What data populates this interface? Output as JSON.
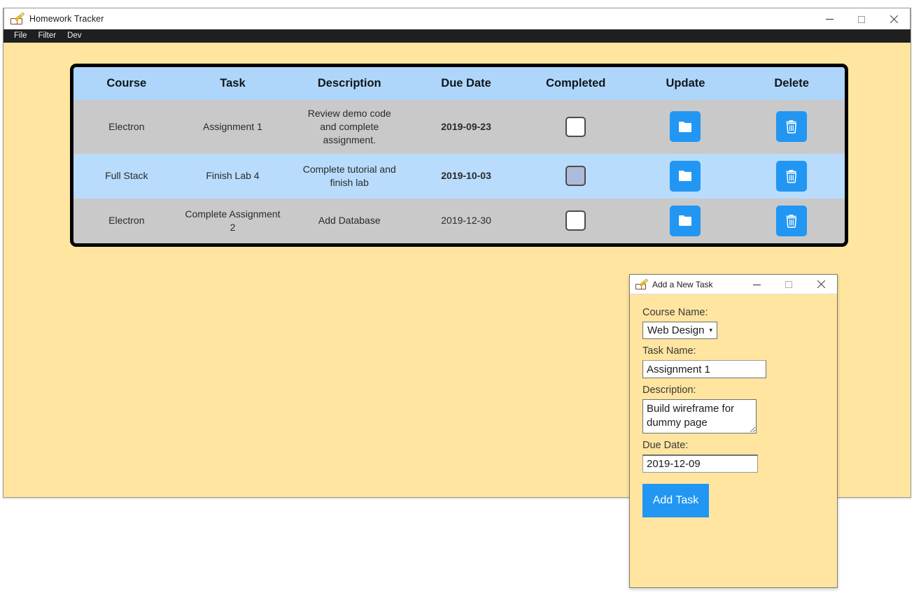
{
  "main_window": {
    "title": "Homework Tracker",
    "icon": "notebook-pencil-icon",
    "controls": {
      "minimize": "minimize-icon",
      "maximize": "maximize-icon",
      "close": "close-icon"
    },
    "menubar": [
      {
        "label": "File"
      },
      {
        "label": "Filter"
      },
      {
        "label": "Dev"
      }
    ],
    "background_color": "#ffe5a0"
  },
  "table": {
    "border_color": "#000000",
    "header_bg": "#aed6fa",
    "row_bg_odd": "#c9c9c9",
    "row_bg_even": "#b9dcfd",
    "overdue_color": "#ff0000",
    "headers": [
      "Course",
      "Task",
      "Description",
      "Due Date",
      "Completed",
      "Update",
      "Delete"
    ],
    "rows": [
      {
        "course": "Electron",
        "task": "Assignment 1",
        "description": "Review demo code and complete assignment.",
        "due_date": "2019-09-23",
        "overdue": true,
        "completed": false,
        "checkbox_state": "unchecked",
        "update_icon": "folder-icon",
        "delete_icon": "trash-icon"
      },
      {
        "course": "Full Stack",
        "task": "Finish Lab 4",
        "description": "Complete tutorial and finish lab",
        "due_date": "2019-10-03",
        "overdue": true,
        "completed": false,
        "checkbox_state": "hovered",
        "update_icon": "folder-icon",
        "delete_icon": "trash-icon"
      },
      {
        "course": "Electron",
        "task": "Complete Assignment 2",
        "description": "Add Database",
        "due_date": "2019-12-30",
        "overdue": false,
        "completed": false,
        "checkbox_state": "unchecked",
        "update_icon": "folder-icon",
        "delete_icon": "trash-icon"
      }
    ]
  },
  "dialog": {
    "title": "Add a New Task",
    "icon": "notebook-pencil-icon",
    "controls": {
      "minimize": "minimize-icon",
      "maximize": "maximize-icon",
      "close": "close-icon"
    },
    "fields": {
      "course_label": "Course Name:",
      "course_value": "Web Design",
      "course_caret": "▾",
      "task_label": "Task Name:",
      "task_value": "Assignment 1",
      "description_label": "Description:",
      "description_value": "Build wireframe for dummy page",
      "due_label": "Due Date:",
      "due_value": "2019-12-09"
    },
    "submit_label": "Add Task",
    "accent_color": "#2196f3"
  }
}
